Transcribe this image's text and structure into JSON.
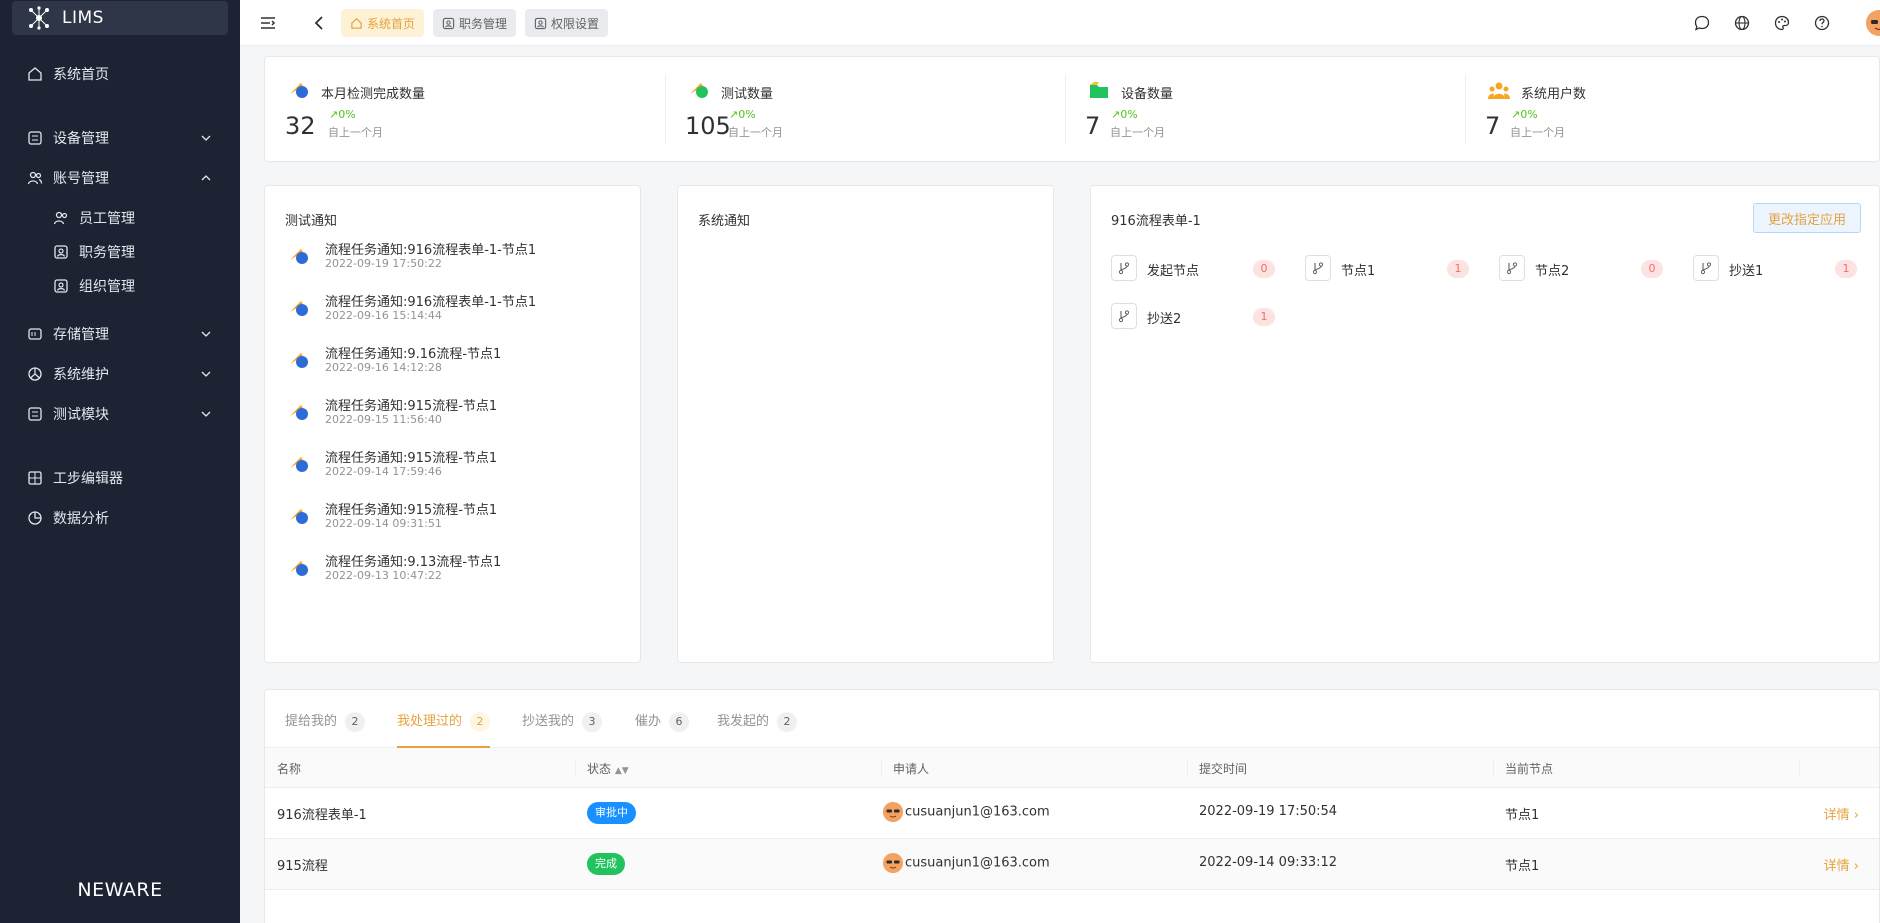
{
  "app": {
    "logo_text": "LIMS",
    "brand_footer": "NEWARE"
  },
  "sidebar": {
    "items": [
      {
        "label": "系统首页"
      },
      {
        "label": "设备管理"
      },
      {
        "label": "账号管理"
      },
      {
        "label": "员工管理"
      },
      {
        "label": "职务管理"
      },
      {
        "label": "组织管理"
      },
      {
        "label": "存储管理"
      },
      {
        "label": "系统维护"
      },
      {
        "label": "测试模块"
      },
      {
        "label": "工步编辑器"
      },
      {
        "label": "数据分析"
      }
    ]
  },
  "topbar": {
    "tags": [
      {
        "label": "系统首页"
      },
      {
        "label": "职务管理"
      },
      {
        "label": "权限设置"
      }
    ]
  },
  "stats": [
    {
      "title": "本月检测完成数量",
      "value": "32",
      "pct": "0%",
      "sub": "自上一个月"
    },
    {
      "title": "测试数量",
      "value": "105",
      "pct": "0%",
      "sub": "自上一个月"
    },
    {
      "title": "设备数量",
      "value": "7",
      "pct": "0%",
      "sub": "自上一个月"
    },
    {
      "title": "系统用户数",
      "value": "7",
      "pct": "0%",
      "sub": "自上一个月"
    }
  ],
  "test_notice": {
    "title": "测试通知",
    "items": [
      {
        "title": "流程任务通知:916流程表单-1-节点1",
        "time": "2022-09-19 17:50:22"
      },
      {
        "title": "流程任务通知:916流程表单-1-节点1",
        "time": "2022-09-16 15:14:44"
      },
      {
        "title": "流程任务通知:9.16流程-节点1",
        "time": "2022-09-16 14:12:28"
      },
      {
        "title": "流程任务通知:915流程-节点1",
        "time": "2022-09-15 11:56:40"
      },
      {
        "title": "流程任务通知:915流程-节点1",
        "time": "2022-09-14 17:59:46"
      },
      {
        "title": "流程任务通知:915流程-节点1",
        "time": "2022-09-14 09:31:51"
      },
      {
        "title": "流程任务通知:9.13流程-节点1",
        "time": "2022-09-13 10:47:22"
      }
    ]
  },
  "system_notice": {
    "title": "系统通知"
  },
  "flow_panel": {
    "title": "916流程表单-1",
    "button": "更改指定应用",
    "nodes": [
      {
        "label": "发起节点",
        "count": "0"
      },
      {
        "label": "节点1",
        "count": "1"
      },
      {
        "label": "节点2",
        "count": "0"
      },
      {
        "label": "抄送1",
        "count": "1"
      },
      {
        "label": "抄送2",
        "count": "1"
      }
    ]
  },
  "task_tabs": [
    {
      "label": "提给我的",
      "count": "2"
    },
    {
      "label": "我处理过的",
      "count": "2"
    },
    {
      "label": "抄送我的",
      "count": "3"
    },
    {
      "label": "催办",
      "count": "6"
    },
    {
      "label": "我发起的",
      "count": "2"
    }
  ],
  "table": {
    "headers": {
      "name": "名称",
      "status": "状态",
      "applicant": "申请人",
      "time": "提交时间",
      "node": "当前节点"
    },
    "rows": [
      {
        "name": "916流程表单-1",
        "status": "审批中",
        "status_color": "#1890ff",
        "applicant": "cusuanjun1@163.com",
        "time": "2022-09-19 17:50:54",
        "node": "节点1",
        "action": "详情"
      },
      {
        "name": "915流程",
        "status": "完成",
        "status_color": "#22c35e",
        "applicant": "cusuanjun1@163.com",
        "time": "2022-09-14 09:33:12",
        "node": "节点1",
        "action": "详情"
      }
    ]
  },
  "colors": {
    "sidebar_bg": "#1d2333",
    "accent": "#e6a23c",
    "success": "#52c41a"
  }
}
